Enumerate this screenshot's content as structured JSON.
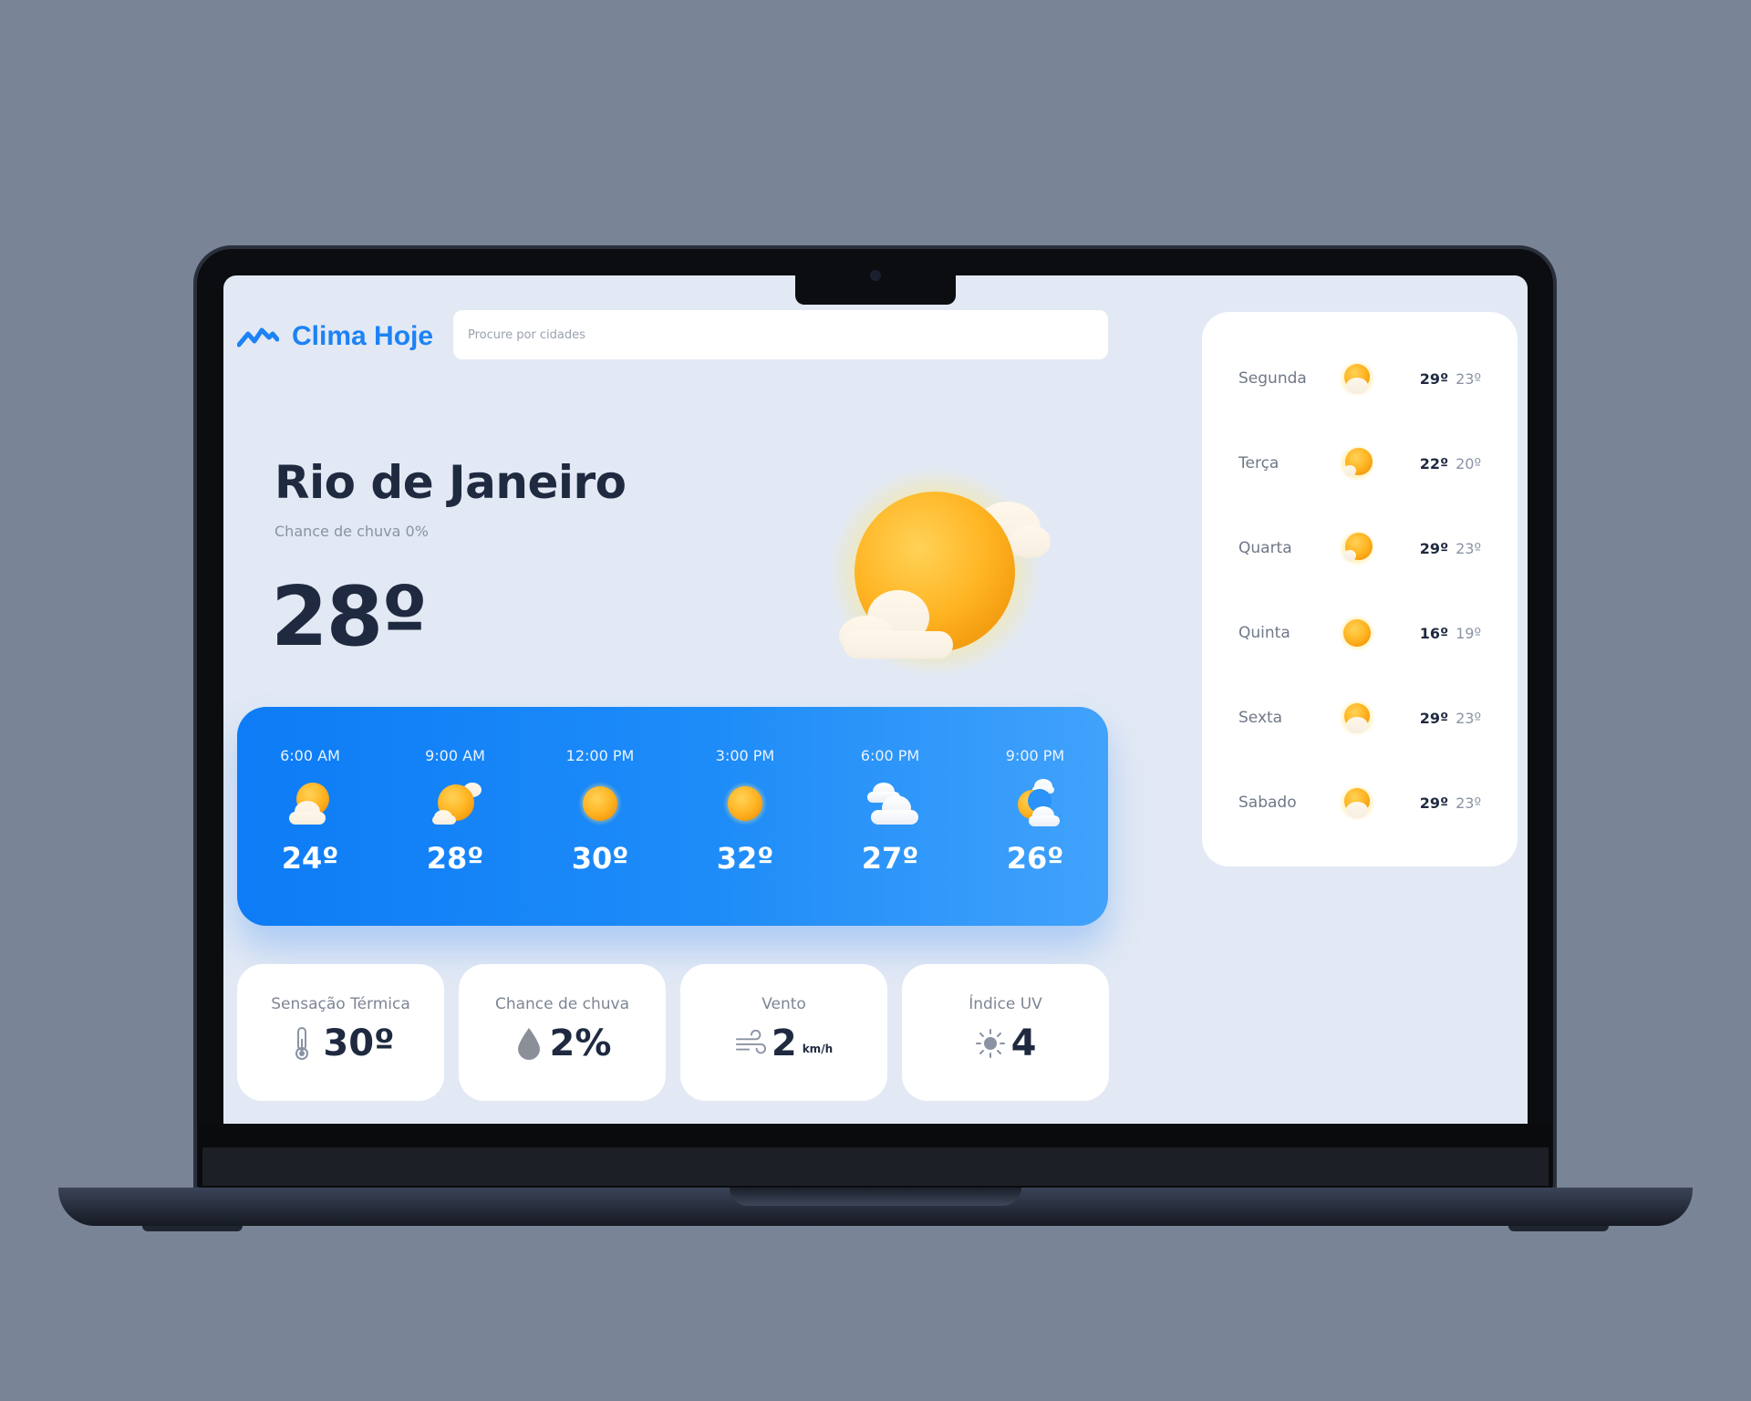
{
  "app": {
    "name": "Clima Hoje",
    "brand_color": "#1d82f5"
  },
  "search": {
    "placeholder": "Procure por cidades"
  },
  "current": {
    "city": "Rio de Janeiro",
    "rain_chance_text": "Chance de chuva 0%",
    "temperature": "28º",
    "icon": "sun-with-clouds-icon"
  },
  "hourly": [
    {
      "time": "6:00 AM",
      "temp": "24º",
      "icon": "cloud-sun-icon"
    },
    {
      "time": "9:00 AM",
      "temp": "28º",
      "icon": "sun-cloud-icon"
    },
    {
      "time": "12:00 PM",
      "temp": "30º",
      "icon": "sun-icon"
    },
    {
      "time": "3:00 PM",
      "temp": "32º",
      "icon": "sun-icon"
    },
    {
      "time": "6:00 PM",
      "temp": "27º",
      "icon": "clouds-icon"
    },
    {
      "time": "9:00 PM",
      "temp": "26º",
      "icon": "moon-clouds-icon"
    }
  ],
  "stats": [
    {
      "label": "Sensação Térmica",
      "value": "30º",
      "unit": "",
      "icon": "thermometer-icon"
    },
    {
      "label": "Chance de chuva",
      "value": "2%",
      "unit": "",
      "icon": "raindrop-icon"
    },
    {
      "label": "Vento",
      "value": "2",
      "unit": "km/h",
      "icon": "wind-icon"
    },
    {
      "label": "Índice UV",
      "value": "4",
      "unit": "",
      "icon": "uv-sun-icon"
    }
  ],
  "week": [
    {
      "day": "Segunda",
      "max": "29º",
      "min": "23º",
      "icon": "cloud-sun-icon"
    },
    {
      "day": "Terça",
      "max": "22º",
      "min": "20º",
      "icon": "sun-cloud-icon"
    },
    {
      "day": "Quarta",
      "max": "29º",
      "min": "23º",
      "icon": "sun-cloud-icon"
    },
    {
      "day": "Quinta",
      "max": "16º",
      "min": "19º",
      "icon": "sun-icon"
    },
    {
      "day": "Sexta",
      "max": "29º",
      "min": "23º",
      "icon": "cloud-sun-icon"
    },
    {
      "day": "Sabado",
      "max": "29º",
      "min": "23º",
      "icon": "cloud-sun-icon"
    }
  ]
}
